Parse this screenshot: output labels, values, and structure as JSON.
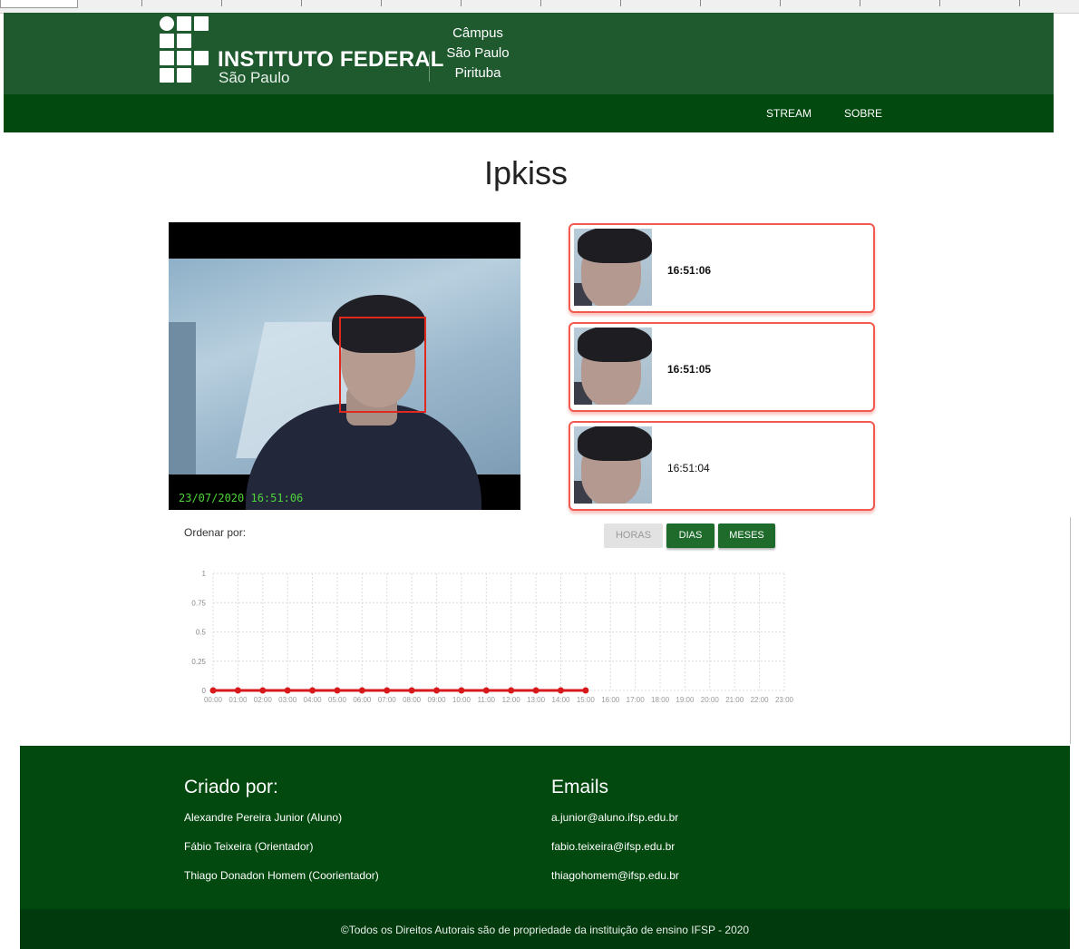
{
  "header": {
    "institution_name": "INSTITUTO FEDERAL",
    "institution_sub": "São Paulo",
    "campus_lines": [
      "Câmpus",
      "São Paulo",
      "Pirituba"
    ],
    "nav": [
      {
        "label": "STREAM"
      },
      {
        "label": "SOBRE"
      }
    ]
  },
  "main": {
    "title": "Ipkiss",
    "video": {
      "timestamp": "23/07/2020 16:51:06"
    },
    "detections": [
      {
        "time": "16:51:06"
      },
      {
        "time": "16:51:05"
      },
      {
        "time": "16:51:04"
      }
    ],
    "order": {
      "label": "Ordenar por:",
      "buttons": [
        {
          "label": "HORAS",
          "state": "disabled"
        },
        {
          "label": "DIAS",
          "state": "active"
        },
        {
          "label": "MESES",
          "state": "active"
        }
      ]
    }
  },
  "chart_data": {
    "type": "line",
    "x": [
      "00:00",
      "01:00",
      "02:00",
      "03:00",
      "04:00",
      "05:00",
      "06:00",
      "07:00",
      "08:00",
      "09:00",
      "10:00",
      "11:00",
      "12:00",
      "13:00",
      "14:00",
      "15:00",
      "16:00",
      "17:00",
      "18:00",
      "19:00",
      "20:00",
      "21:00",
      "22:00",
      "23:00"
    ],
    "values": [
      0,
      0,
      0,
      0,
      0,
      0,
      0,
      0,
      0,
      0,
      0,
      0,
      0,
      0,
      0,
      0
    ],
    "y_ticks": [
      "0",
      "0.25",
      "0.5",
      "0.75",
      "1"
    ],
    "ylim": [
      0,
      1
    ],
    "grid": true,
    "line_color": "#d7191c"
  },
  "footer": {
    "created_heading": "Criado por:",
    "emails_heading": "Emails",
    "people": [
      {
        "name": "Alexandre Pereira Junior (Aluno)",
        "email": "a.junior@aluno.ifsp.edu.br"
      },
      {
        "name": "Fábio Teixeira (Orientador)",
        "email": "fabio.teixeira@ifsp.edu.br"
      },
      {
        "name": "Thiago Donadon Homem (Coorientador)",
        "email": "thiagohomem@ifsp.edu.br"
      }
    ],
    "copyright": "©Todos os Direitos Autorais são de propriedade da instituição de ensino IFSP - 2020"
  },
  "colors": {
    "header_green": "#1f5a2f",
    "nav_green": "#02490f",
    "footer_green": "#02490f",
    "button_green": "#1e6b2c",
    "card_border": "#f15a4f",
    "face_box": "#e0281e",
    "video_timestamp": "#4fd33a"
  }
}
